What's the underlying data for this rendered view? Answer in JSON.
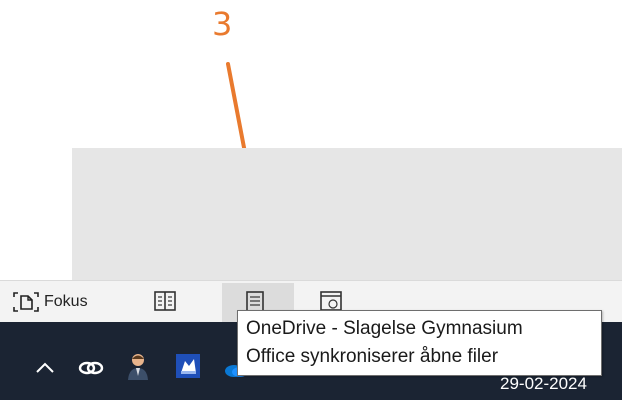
{
  "annotation": {
    "step_number": "3",
    "color": "#e97a2e"
  },
  "status_bar": {
    "focus_label": "Fokus",
    "icons": [
      "focus-icon",
      "read-mode-icon",
      "print-layout-icon",
      "web-layout-icon"
    ]
  },
  "tooltip": {
    "line1": "OneDrive - Slagelse Gymnasium",
    "line2": "Office synkroniserer åbne filer"
  },
  "taskbar": {
    "date": "29-02-2024",
    "tray_icons": [
      "chevron-up-icon",
      "link-icon",
      "person-icon",
      "app-icon",
      "onedrive-icon"
    ],
    "background": "#1b2433"
  }
}
